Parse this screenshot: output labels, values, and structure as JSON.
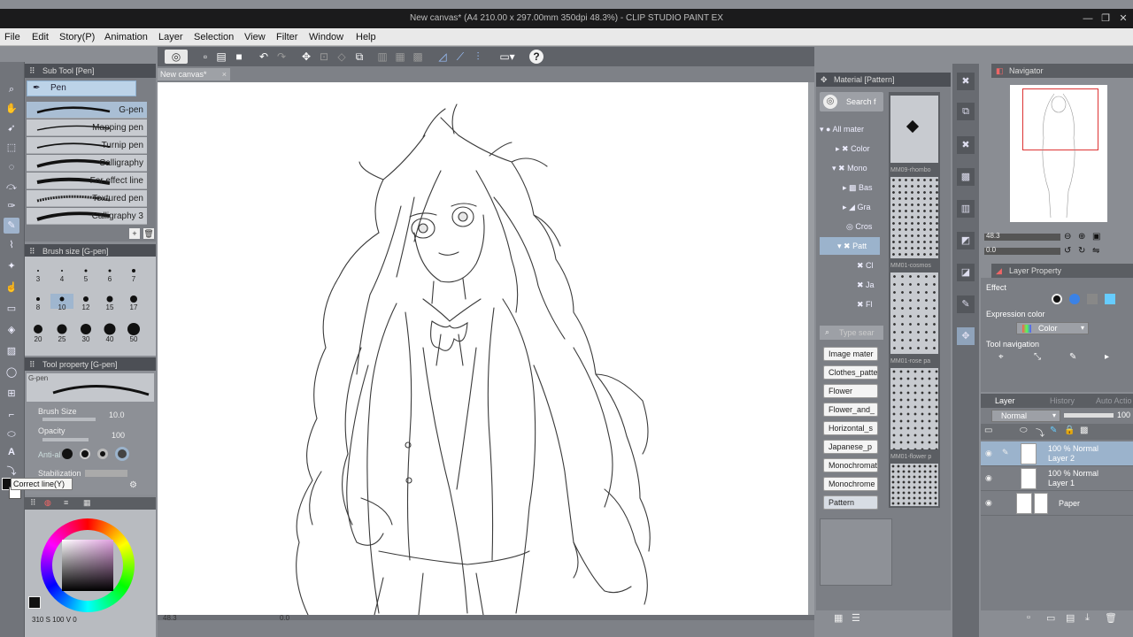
{
  "app": {
    "title": "New canvas* (A4 210.00 x 297.00mm 350dpi 48.3%) - CLIP STUDIO PAINT EX"
  },
  "window_controls": {
    "minimize": "—",
    "maximize": "❐",
    "close": "✕"
  },
  "menu": [
    "File",
    "Edit",
    "Story(P)",
    "Animation",
    "Layer",
    "Selection",
    "View",
    "Filter",
    "Window",
    "Help"
  ],
  "document_tab": {
    "label": "New canvas*"
  },
  "sub_tool": {
    "title": "Sub Tool [Pen]",
    "tab_label": "Pen",
    "brushes": [
      "G-pen",
      "Mapping pen",
      "Turnip pen",
      "Calligraphy",
      "For effect line",
      "Textured pen",
      "Calligraphy 3"
    ],
    "selected": "G-pen"
  },
  "brush_size": {
    "title": "Brush size [G-pen]",
    "sizes": [
      "3",
      "4",
      "5",
      "6",
      "7",
      "8",
      "10",
      "12",
      "15",
      "17",
      "20",
      "25",
      "30",
      "40",
      "50"
    ],
    "selected": "10"
  },
  "tool_property": {
    "title": "Tool property [G-pen]",
    "preview_label": "G-pen",
    "brush_size_label": "Brush Size",
    "brush_size_value": "10.0",
    "opacity_label": "Opacity",
    "opacity_value": "100",
    "antialias_label": "Anti-al",
    "stabilization_label": "Stabilization"
  },
  "tooltip": {
    "text": "Correct line(Y)"
  },
  "color_readout": {
    "a": "310",
    "b": "100",
    "c": "0"
  },
  "material": {
    "title": "Material [Pattern]",
    "search_placeholder": "Search f",
    "tree": [
      "All mater",
      "Color",
      "Mono",
      "Bas",
      "Gra",
      "Cros",
      "Patt",
      "Cl",
      "Ja",
      "Fl"
    ],
    "tag_search_placeholder": "Type sear",
    "tags": [
      "Image mater",
      "Clothes_patte",
      "Flower",
      "Flower_and_",
      "Horizontal_s",
      "Japanese_p",
      "Monochromat",
      "Monochrome",
      "Pattern"
    ],
    "textures": [
      "MM09-rhombo",
      "MM01-cosmos",
      "MM01-rose pa",
      "MM01-flower p"
    ]
  },
  "navigator": {
    "title": "Navigator",
    "zoom": "48.3",
    "rotation": "0.0"
  },
  "layer_property": {
    "title": "Layer Property",
    "effect_label": "Effect",
    "expression_color_label": "Expression color",
    "expression_color_value": "Color",
    "tool_navigation_label": "Tool navigation"
  },
  "layer_panel": {
    "tabs": [
      "Layer",
      "History",
      "Auto Actio"
    ],
    "blend_mode": "Normal",
    "opacity": "100",
    "layers": [
      {
        "mode": "100 % Normal",
        "name": "Layer 2"
      },
      {
        "mode": "100 % Normal",
        "name": "Layer 1"
      },
      {
        "mode": "",
        "name": "Paper"
      }
    ]
  },
  "status": {
    "zoom": "48.3",
    "angle": "0.0"
  },
  "colors": {
    "accent": "#9fb3cc",
    "panel": "#7b7e84",
    "titlebar": "#1b1b1c"
  }
}
